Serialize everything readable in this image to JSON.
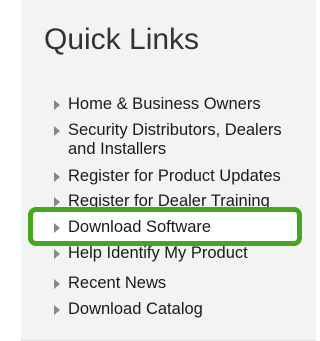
{
  "quick_links": {
    "title": "Quick Links",
    "highlight_color": "#46a521",
    "items": [
      {
        "label": "Home & Business Owners",
        "icon": "triangle-right-icon"
      },
      {
        "label": "Security Distributors, Dealers and Installers",
        "icon": "triangle-right-icon"
      },
      {
        "label": "Register for Product Updates",
        "icon": "triangle-right-icon"
      },
      {
        "label": "Register for Dealer Training",
        "icon": "triangle-right-icon"
      },
      {
        "label": "Download Software",
        "icon": "triangle-right-icon",
        "highlighted": true
      },
      {
        "label": "Help Identify My Product",
        "icon": "triangle-right-icon"
      },
      {
        "label": "Recent News",
        "icon": "triangle-right-icon"
      },
      {
        "label": "Download Catalog",
        "icon": "triangle-right-icon"
      }
    ]
  }
}
